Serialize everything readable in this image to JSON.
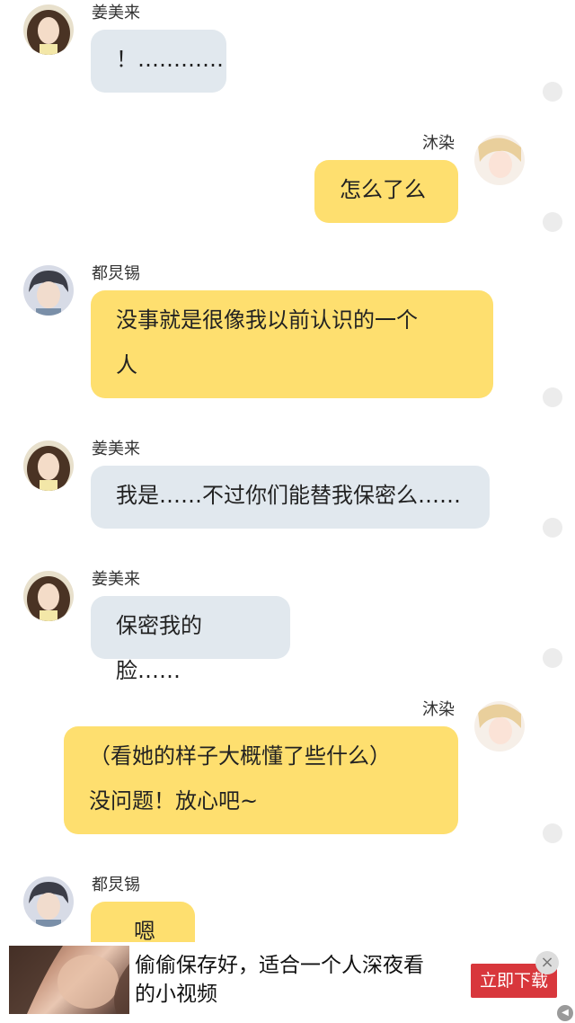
{
  "messages": [
    {
      "speaker": "姜美来",
      "text": "！…………"
    },
    {
      "speaker": "沐染",
      "text": "怎么了么"
    },
    {
      "speaker": "都炅锡",
      "text": "没事就是很像我以前认识的一个\n人"
    },
    {
      "speaker": "姜美来",
      "text": "我是……不过你们能替我保密么……"
    },
    {
      "speaker": "姜美来",
      "text": "保密我的脸……"
    },
    {
      "speaker": "沐染",
      "text": "（看她的样子大概懂了些什么）\n没问题！放心吧~"
    },
    {
      "speaker": "都炅锡",
      "text": "嗯"
    }
  ],
  "ad": {
    "text": "偷偷保存好，适合一个人深夜看\n的小视频",
    "button_label": "立即下载",
    "close_glyph": "×",
    "corner_glyph": "◀"
  },
  "colors": {
    "bubble_other": "#e1e8ee",
    "bubble_self": "#fedf6f",
    "ad_button": "#d8373c"
  },
  "icons": {
    "avatar_jiang": "avatar-jiangmeilai",
    "avatar_mu": "avatar-muran",
    "avatar_du": "avatar-dujiongxi"
  }
}
